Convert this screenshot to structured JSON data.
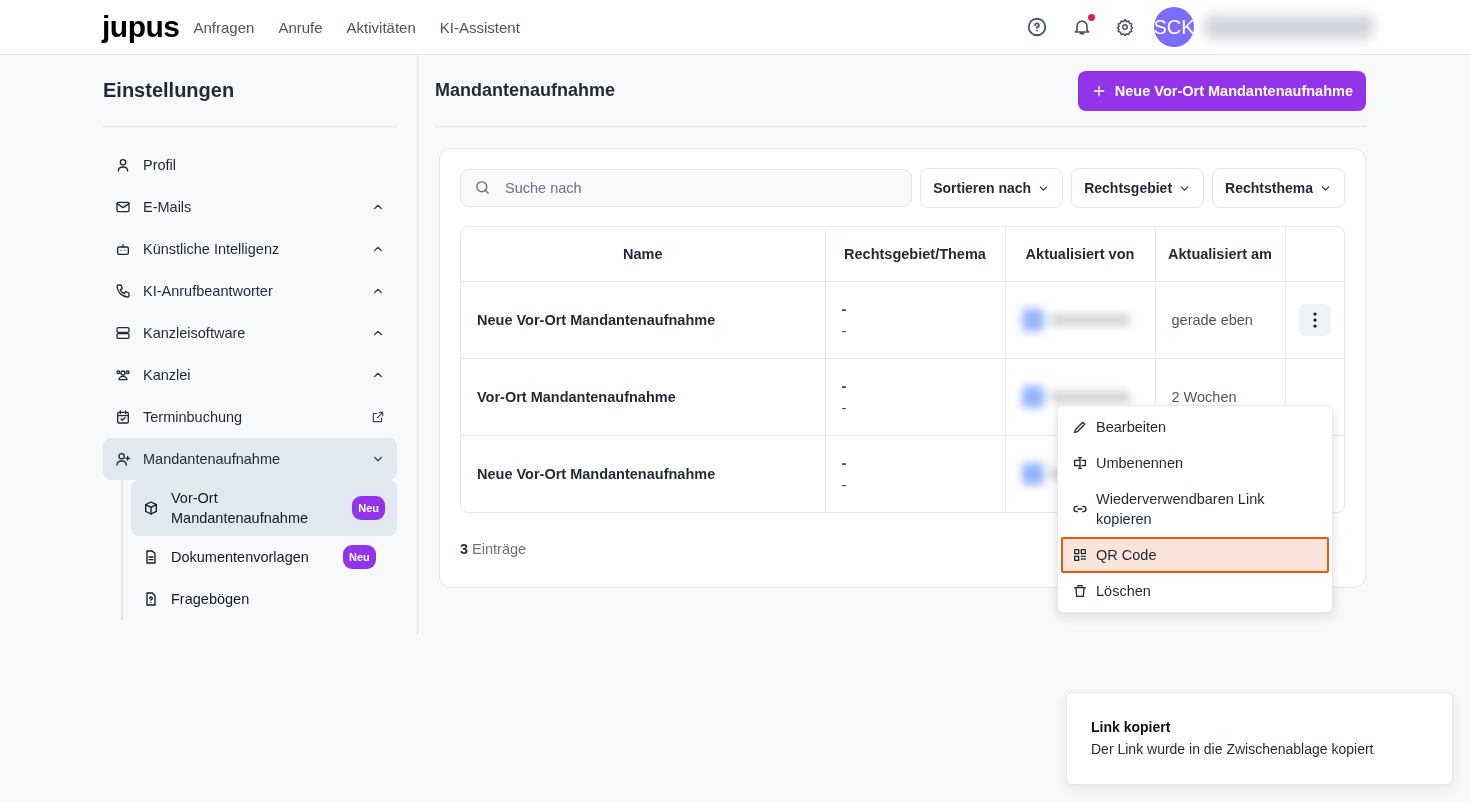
{
  "header": {
    "logo": "jupus",
    "nav": [
      {
        "label": "Anfragen"
      },
      {
        "label": "Anrufe"
      },
      {
        "label": "Aktivitäten"
      },
      {
        "label": "KI-Assistent"
      }
    ],
    "notification_dot": true,
    "avatar": "SCK"
  },
  "sidebar": {
    "title": "Einstellungen",
    "items": [
      {
        "label": "Profil",
        "kind": "link",
        "selected": false
      },
      {
        "label": "E-Mails",
        "kind": "group",
        "expanded": false,
        "selected": false
      },
      {
        "label": "Künstliche Intelligenz",
        "kind": "group",
        "expanded": false,
        "selected": false
      },
      {
        "label": "KI-Anrufbeantworter",
        "kind": "group",
        "expanded": false,
        "selected": false
      },
      {
        "label": "Kanzleisoftware",
        "kind": "group",
        "expanded": false,
        "selected": false
      },
      {
        "label": "Kanzlei",
        "kind": "group",
        "expanded": false,
        "selected": false
      },
      {
        "label": "Terminbuchung",
        "kind": "external",
        "selected": false
      },
      {
        "label": "Mandantenaufnahme",
        "kind": "group",
        "expanded": true,
        "selected": true,
        "children": [
          {
            "label": "Vor-Ort Mandantenaufnahme",
            "badge": "Neu",
            "selected": true
          },
          {
            "label": "Dokumentenvorlagen",
            "badge": "Neu",
            "selected": false
          },
          {
            "label": "Fragebögen",
            "selected": false
          }
        ]
      }
    ]
  },
  "main": {
    "title": "Mandantenaufnahme",
    "new_button": "Neue Vor-Ort Mandantenaufnahme",
    "search": {
      "placeholder": "Suche nach"
    },
    "filters": [
      "Sortieren nach",
      "Rechtsgebiet",
      "Rechtsthema"
    ],
    "table": {
      "columns": [
        "Name",
        "Rechtsgebiet/Thema",
        "Aktualisiert von",
        "Aktualisiert am"
      ],
      "rows": [
        {
          "name": "Neue Vor-Ort Mandantenaufnahme",
          "area": "-",
          "topic": "-",
          "updated_at": "gerade eben",
          "highlighted": true
        },
        {
          "name": "Vor-Ort Mandantenaufnahme",
          "area": "-",
          "topic": "-",
          "updated_at": "2 Wochen"
        },
        {
          "name": "Neue Vor-Ort Mandantenaufnahme",
          "area": "-",
          "topic": "-"
        }
      ]
    },
    "count": "**3** Einträge"
  },
  "menu": {
    "items": [
      {
        "label": "Bearbeiten",
        "selected": false
      },
      {
        "label": "Umbenennen",
        "selected": false
      },
      {
        "label": "Wiederverwendbaren Link kopieren",
        "selected": false
      },
      {
        "label": "QR Code",
        "selected": true
      },
      {
        "label": "Löschen",
        "selected": false
      }
    ]
  },
  "toast": {
    "title": "Link kopiert",
    "message": "Der Link wurde in die Zwischenablage kopiert"
  }
}
